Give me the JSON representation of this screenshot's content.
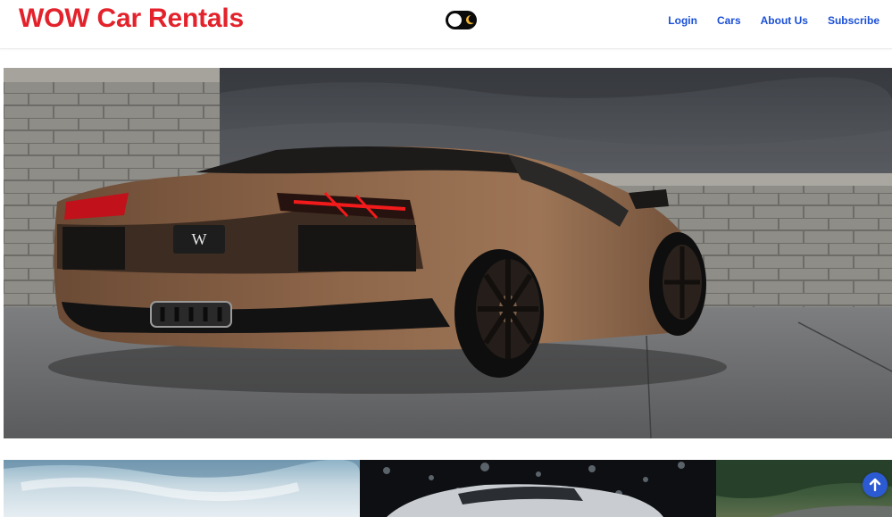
{
  "header": {
    "brand": "WOW Car Rentals",
    "theme_toggle_icon": "moon-icon",
    "nav": [
      {
        "label": "Login"
      },
      {
        "label": "Cars"
      },
      {
        "label": "About Us"
      },
      {
        "label": "Subscribe"
      }
    ]
  },
  "hero": {
    "image": "brown-lamborghini-rear-three-quarter-view",
    "plate_text": "W"
  },
  "gallery": {
    "tiles": [
      {
        "image": "car-under-blue-sky"
      },
      {
        "image": "silver-supercar-in-showroom"
      },
      {
        "image": "car-on-forest-road"
      }
    ]
  },
  "scroll_top": {
    "icon": "arrow-up-icon"
  },
  "colors": {
    "brand": "#e3222b",
    "link": "#1a4fd6",
    "toggle_bg": "#0b0b0b",
    "moon": "#f2b531",
    "scroll_button": "#2c5ad3"
  }
}
